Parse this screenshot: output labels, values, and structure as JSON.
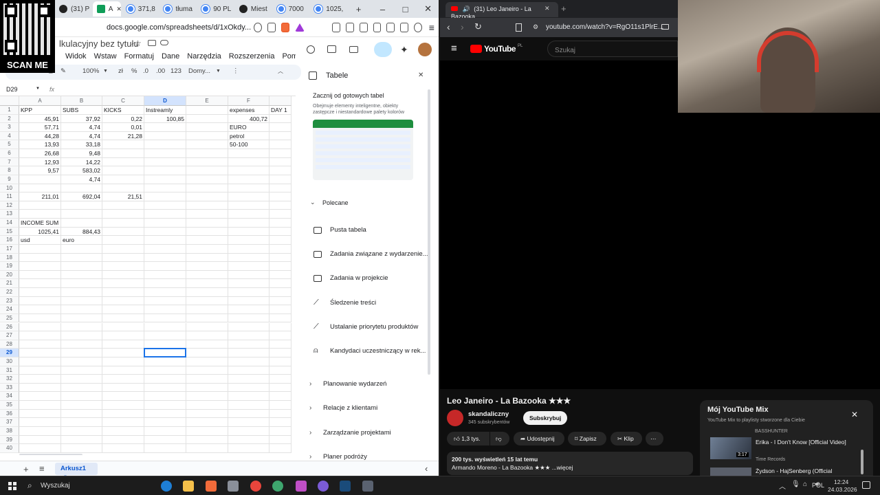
{
  "left": {
    "tabs": [
      {
        "label": "(31) P"
      },
      {
        "label": "A"
      },
      {
        "label": "371,8"
      },
      {
        "label": "tłuma"
      },
      {
        "label": "90 PL"
      },
      {
        "label": "Miest"
      },
      {
        "label": "7000"
      },
      {
        "label": "1025,"
      }
    ],
    "new_tab": "+",
    "win_min": "–",
    "win_max": "□",
    "win_close": "✕",
    "url": "docs.google.com/spreadsheets/d/1xOkdy...",
    "doc_title": "lkulacyjny bez tytułu",
    "menu": [
      "Widok",
      "Wstaw",
      "Formatuj",
      "Dane",
      "Narzędzia",
      "Rozszerzenia",
      "Pomoc"
    ],
    "toolbar": {
      "zoom": "100%",
      "currency": "zł",
      "percent": "%",
      "dec_less": ".0",
      "dec_more": ".00",
      "format": "123",
      "font": "Domy...",
      "more": "⋮"
    },
    "namebox": "D29",
    "fx": "fx",
    "columns": [
      "A",
      "B",
      "C",
      "D",
      "E",
      "F"
    ],
    "rows": [
      [
        "KPP",
        "SUBS",
        "KICKS",
        "Instreamly",
        "",
        "expenses",
        "DAY 1"
      ],
      [
        "45,91",
        "37,92",
        "0,22",
        "100,85",
        "",
        "400,72",
        ""
      ],
      [
        "57,71",
        "4,74",
        "0,01",
        "",
        "",
        "EURO",
        ""
      ],
      [
        "44,28",
        "4,74",
        "21,28",
        "",
        "",
        "petrol",
        ""
      ],
      [
        "13,93",
        "33,18",
        "",
        "",
        "",
        "50-100",
        ""
      ],
      [
        "26,68",
        "9,48",
        "",
        "",
        "",
        "",
        ""
      ],
      [
        "12,93",
        "14,22",
        "",
        "",
        "",
        "",
        ""
      ],
      [
        "9,57",
        "583,02",
        "",
        "",
        "",
        "",
        ""
      ],
      [
        "",
        "4,74",
        "",
        "",
        "",
        "",
        ""
      ],
      [
        "",
        "",
        "",
        "",
        "",
        "",
        ""
      ],
      [
        "211,01",
        "692,04",
        "21,51",
        "",
        "",
        "",
        ""
      ],
      [
        "",
        "",
        "",
        "",
        "",
        "",
        ""
      ],
      [
        "",
        "",
        "",
        "",
        "",
        "",
        ""
      ],
      [
        "INCOME SUM",
        "",
        "",
        "",
        "",
        "",
        ""
      ],
      [
        "1025,41",
        "884,43",
        "",
        "",
        "",
        "",
        ""
      ],
      [
        "usd",
        "euro",
        "",
        "",
        "",
        "",
        ""
      ]
    ],
    "row_count": 40,
    "selected_row": 29,
    "sheet_tab": "Arkusz1",
    "add_sheet": "+",
    "sheet_list": "≡",
    "collapse": "‹"
  },
  "panel": {
    "title": "Tabele",
    "close": "✕",
    "intro_title": "Zacznij od gotowych tabel",
    "intro_text": "Obejmuje elementy inteligentne, obiekty zastępcze i niestandardowe palety kolorów",
    "section": "Polecane",
    "items": [
      "Pusta tabela",
      "Zadania związane z wydarzenie...",
      "Zadania w projekcie",
      "Śledzenie treści",
      "Ustalanie priorytetu produktów",
      "Kandydaci uczestniczący w rek..."
    ],
    "groups": [
      "Planowanie wydarzeń",
      "Relacje z klientami",
      "Zarządzanie projektami",
      "Planer podróży"
    ]
  },
  "right": {
    "tab_title": "(31) Leo Janeiro - La Bazooka",
    "tab_close": "✕",
    "new_tab": "+",
    "url": "youtube.com/watch?v=RgO11s1PlrE...",
    "yt_logo": "YouTube",
    "yt_region": "PL",
    "search_placeholder": "Szukaj",
    "video_title": "Leo Janeiro - La Bazooka ★★★",
    "channel": "skandaliczny",
    "subs": "345 subskrybentów",
    "subscribe": "Subskrybuj",
    "likes": "1,3 tys.",
    "share": "Udostępnij",
    "save": "Zapisz",
    "clip": "Klip",
    "more": "⋯",
    "desc_line1": "200 tys. wyświetleń  15 lat temu",
    "desc_line2": "Armando Moreno - La Bazooka ★★★ ...więcej",
    "mix": {
      "title": "Mój YouTube Mix",
      "subtitle": "YouTube Mix to playlisty stworzone dla Ciebie",
      "close": "✕",
      "prev_channel": "BASSHUNTER",
      "items": [
        {
          "title": "Erika - I Don't Know [Official Video]",
          "channel": "Time Records",
          "duration": "3:17"
        },
        {
          "title": "Żydson - HajSenberg (Official",
          "channel": "",
          "duration": ""
        }
      ]
    }
  },
  "qr": {
    "label": "SCAN ME"
  },
  "taskbar": {
    "search": "Wyszukaj",
    "lang": "POL",
    "time": "12:24",
    "date": "24.03.2026"
  }
}
